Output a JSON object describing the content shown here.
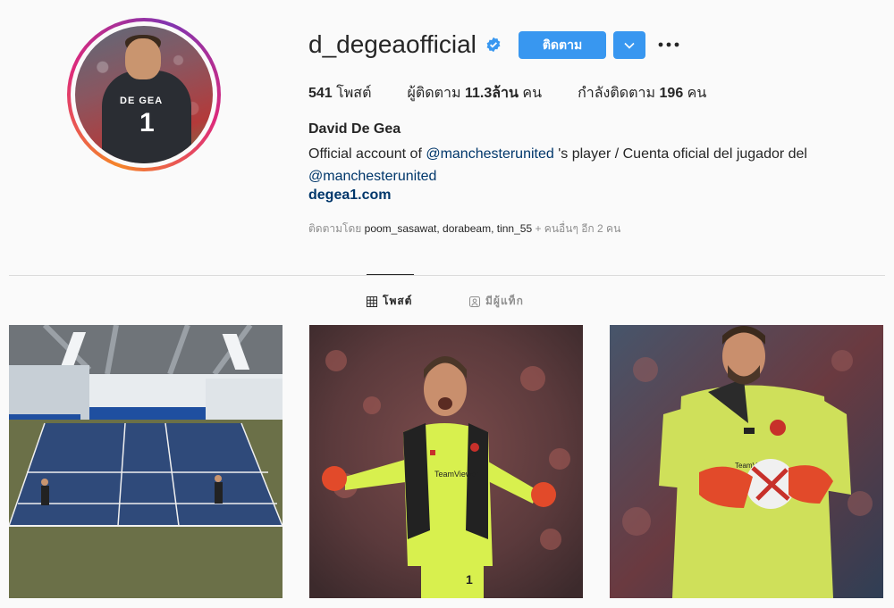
{
  "profile": {
    "username": "d_degeaofficial",
    "full_name": "David De Gea",
    "verified": true,
    "follow_label": "ติดตาม",
    "stats": {
      "posts_count": "541",
      "posts_label": "โพสต์",
      "followers_label": "ผู้ติดตาม",
      "followers_count": "11.3ล้าน",
      "followers_unit": "คน",
      "following_label": "กำลังติดตาม",
      "following_count": "196",
      "following_unit": "คน"
    },
    "bio": {
      "line1_prefix": "Official account of ",
      "mention1": "@manchesterunited",
      "line1_suffix": " 's player / Cuenta oficial del jugador del",
      "mention2": "@manchesterunited"
    },
    "website": "degea1.com",
    "followed_by": {
      "prefix": "ติดตามโดย ",
      "user1": "poom_sasawat",
      "user2": "dorabeam",
      "user3": "tinn_55",
      "suffix": " + คนอื่นๆ อีก 2 คน"
    },
    "avatar": {
      "jersey_name": "DE GEA",
      "jersey_number": "1"
    }
  },
  "tabs": {
    "posts_label": "โพสต์",
    "tagged_label": "มีผู้แท็ก"
  },
  "posts": [
    {
      "description": "tennis-court-indoor"
    },
    {
      "description": "goalkeeper-celebrating",
      "sponsor": "TeamViewer"
    },
    {
      "description": "goalkeeper-holding-ball"
    }
  ],
  "colors": {
    "accent": "#3897f0",
    "link": "#00376b",
    "muted": "#8e8e8e"
  }
}
